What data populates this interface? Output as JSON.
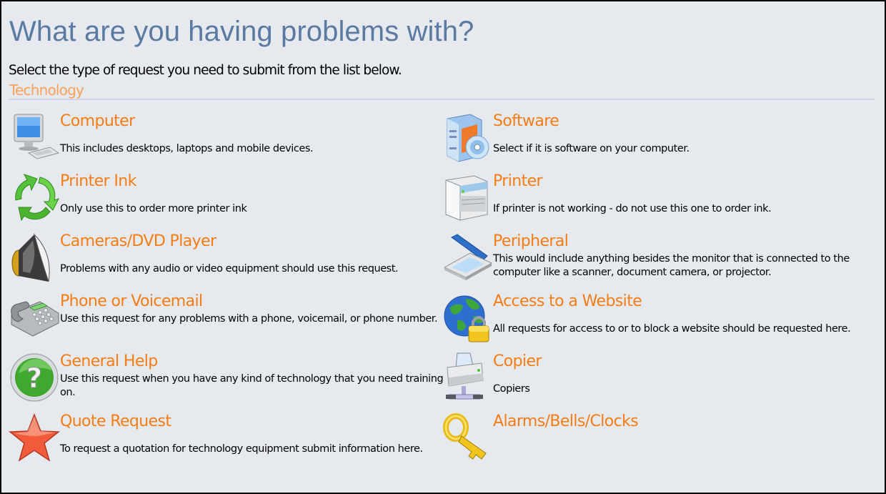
{
  "page": {
    "title": "What are you having problems with?",
    "intro": "Select the type of request you need to submit from the list below.",
    "section_label": "Technology"
  },
  "colors": {
    "title": "#5a7aa2",
    "section_label": "#f8a15a",
    "item_title": "#f57c13",
    "background": "#e6eaef"
  },
  "items": [
    {
      "title": "Computer",
      "description": "This includes desktops, laptops and mobile devices.",
      "icon": "computer-icon"
    },
    {
      "title": "Software",
      "description": "Select if it is software on your computer.",
      "icon": "software-icon"
    },
    {
      "title": "Printer Ink",
      "description": "Only use this to order more printer ink",
      "icon": "recycle-icon"
    },
    {
      "title": "Printer",
      "description": "If printer is not working - do not use this one to order ink.",
      "icon": "printer-icon"
    },
    {
      "title": "Cameras/DVD Player",
      "description": "Problems with any audio or video equipment should use this request.",
      "icon": "speaker-icon"
    },
    {
      "title": "Peripheral",
      "description": "This would include anything besides the monitor that is connected to the computer like a scanner, document camera, or projector.",
      "icon": "scanner-icon"
    },
    {
      "title": "Phone or Voicemail",
      "description": "Use this request for any problems with a phone, voicemail, or phone number.",
      "icon": "phone-icon"
    },
    {
      "title": "Access to a Website",
      "description": "All requests for access to or to block a website should be requested here.",
      "icon": "globe-lock-icon"
    },
    {
      "title": "General Help",
      "description": "Use this request when you have any kind of technology that you need training on.",
      "icon": "help-icon"
    },
    {
      "title": "Copier",
      "description": "Copiers",
      "icon": "network-printer-icon"
    },
    {
      "title": "Quote Request",
      "description": "To request a quotation for technology equipment submit information here.",
      "icon": "star-icon"
    },
    {
      "title": "Alarms/Bells/Clocks",
      "description": "",
      "icon": "key-icon"
    }
  ]
}
